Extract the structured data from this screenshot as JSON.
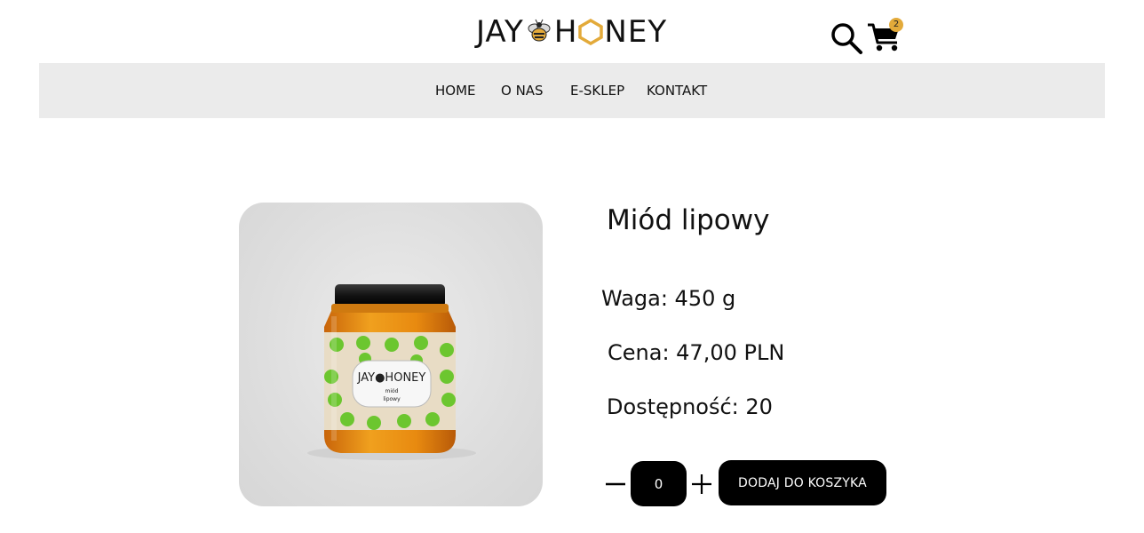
{
  "header": {
    "logo_left": "JAY",
    "logo_right": "NEY",
    "search_icon": "search-icon",
    "cart_icon": "cart-icon",
    "cart_count": "2"
  },
  "nav": {
    "items": [
      {
        "label": "HOME"
      },
      {
        "label": "O NAS"
      },
      {
        "label": "E-SKLEP"
      },
      {
        "label": "KONTAKT"
      }
    ]
  },
  "product": {
    "name": "Miód lipowy",
    "weight": "Waga: 450 g",
    "price": "Cena: 47,00 PLN",
    "availability": "Dostępność: 20",
    "label_brand_left": "JAY",
    "label_brand_right": "HONEY",
    "label_line1": "miód",
    "label_line2": "lipowy",
    "image_alt": "honey jar"
  },
  "cart_controls": {
    "quantity": "0",
    "add_label": "DODAJ DO KOSZYKA"
  },
  "colors": {
    "accent": "#e3aa3a",
    "nav_bg": "#ebebeb",
    "button_bg": "#000000",
    "label_leaf": "#6cc62f"
  }
}
